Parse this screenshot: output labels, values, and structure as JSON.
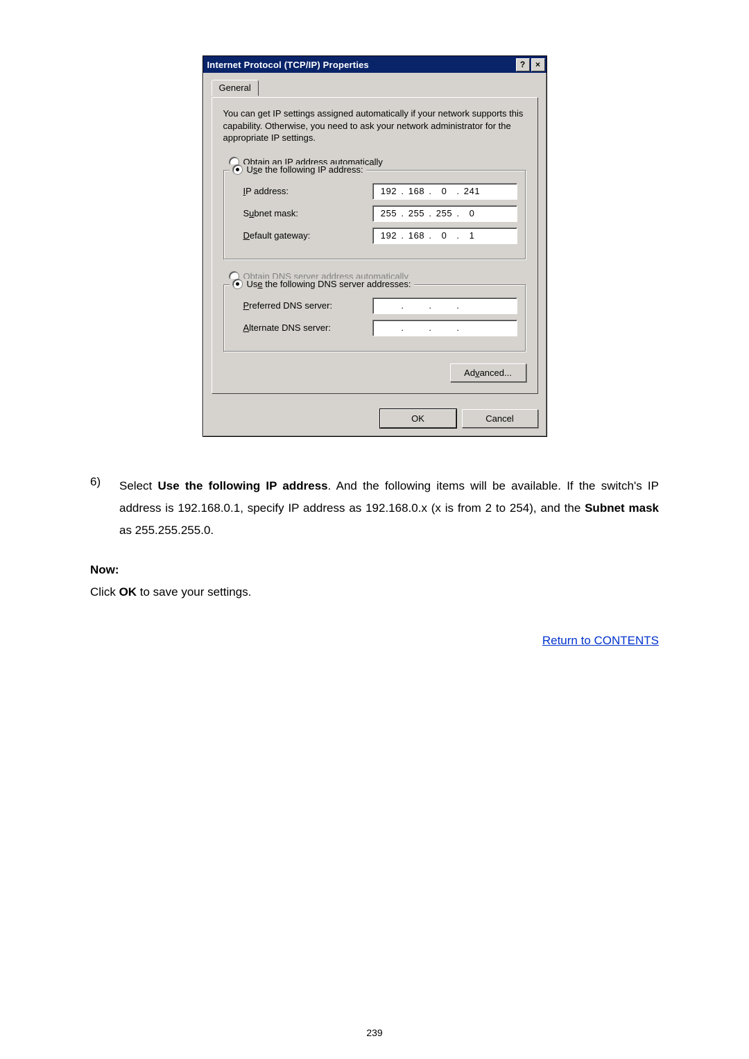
{
  "dialog": {
    "title": "Internet Protocol (TCP/IP) Properties",
    "help_glyph": "?",
    "close_glyph": "×",
    "tab_general": "General",
    "description": "You can get IP settings assigned automatically if your network supports this capability. Otherwise, you need to ask your network administrator for the appropriate IP settings.",
    "radio_obtain_ip": "Obtain an IP address automatically",
    "radio_use_ip": "Use the following IP address:",
    "ip_label": "IP address:",
    "subnet_label": "Subnet mask:",
    "gateway_label": "Default gateway:",
    "ip_value": [
      "192",
      "168",
      "0",
      "241"
    ],
    "subnet_value": [
      "255",
      "255",
      "255",
      "0"
    ],
    "gateway_value": [
      "192",
      "168",
      "0",
      "1"
    ],
    "radio_obtain_dns": "Obtain DNS server address automatically",
    "radio_use_dns": "Use the following DNS server addresses:",
    "pref_dns_label": "Preferred DNS server:",
    "alt_dns_label": "Alternate DNS server:",
    "advanced_btn": "Advanced...",
    "ok_btn": "OK",
    "cancel_btn": "Cancel",
    "underline_letters": {
      "obtain_ip": "O",
      "use_ip": "s",
      "ip": "I",
      "subnet": "u",
      "gateway": "D",
      "obtain_dns": "b",
      "use_dns": "e",
      "pref": "P",
      "alt": "A",
      "adv": "v"
    }
  },
  "doc": {
    "list_num": "6)",
    "list_text_pre": "Select ",
    "list_text_bold1": "Use the following IP address",
    "list_text_mid": ". And the following items will be available. If the switch's IP address is 192.168.0.1, specify IP address as 192.168.0.x (x is from 2 to 254), and the ",
    "list_text_bold2": "Subnet mask",
    "list_text_post": " as 255.255.255.0.",
    "now_label": "Now:",
    "click_pre": "Click ",
    "click_bold": "OK",
    "click_post": " to save your settings.",
    "return_link": "Return to CONTENTS",
    "page_number": "239"
  }
}
